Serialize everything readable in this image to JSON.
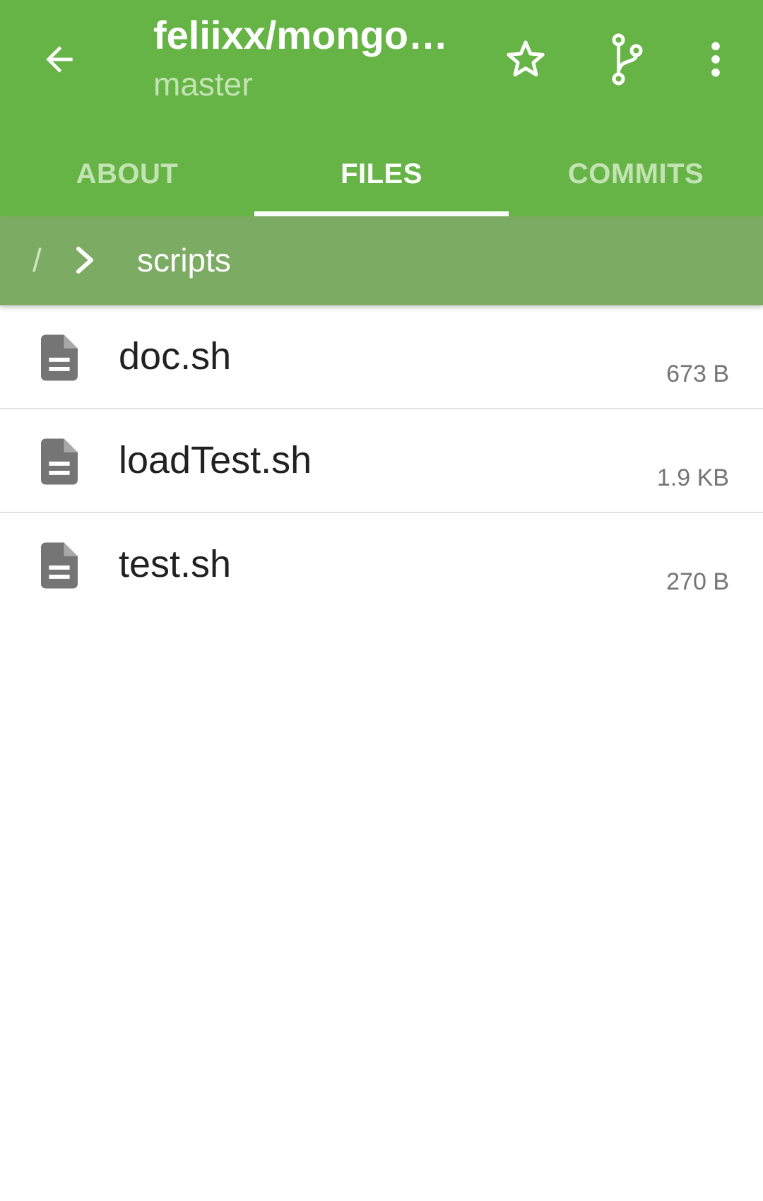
{
  "header": {
    "title": "feliixx/mongo…",
    "subtitle": "master",
    "icons": {
      "back": "arrow-back-icon",
      "star": "star-outline-icon",
      "branch": "git-branch-icon",
      "more": "more-vert-icon"
    }
  },
  "tabs": [
    {
      "label": "ABOUT",
      "active": false
    },
    {
      "label": "FILES",
      "active": true
    },
    {
      "label": "COMMITS",
      "active": false
    }
  ],
  "breadcrumb": {
    "root": "/",
    "separator_icon": "chevron-right-icon",
    "current": "scripts"
  },
  "files": [
    {
      "name": "doc.sh",
      "size": "673 B",
      "icon": "file-document-icon"
    },
    {
      "name": "loadTest.sh",
      "size": "1.9 KB",
      "icon": "file-document-icon"
    },
    {
      "name": "test.sh",
      "size": "270 B",
      "icon": "file-document-icon"
    }
  ],
  "colors": {
    "toolbar": "#66b446",
    "breadcrumb_bar": "#7cab64",
    "inactive_tab_text": "#c4e3b4",
    "file_icon": "#757575"
  }
}
